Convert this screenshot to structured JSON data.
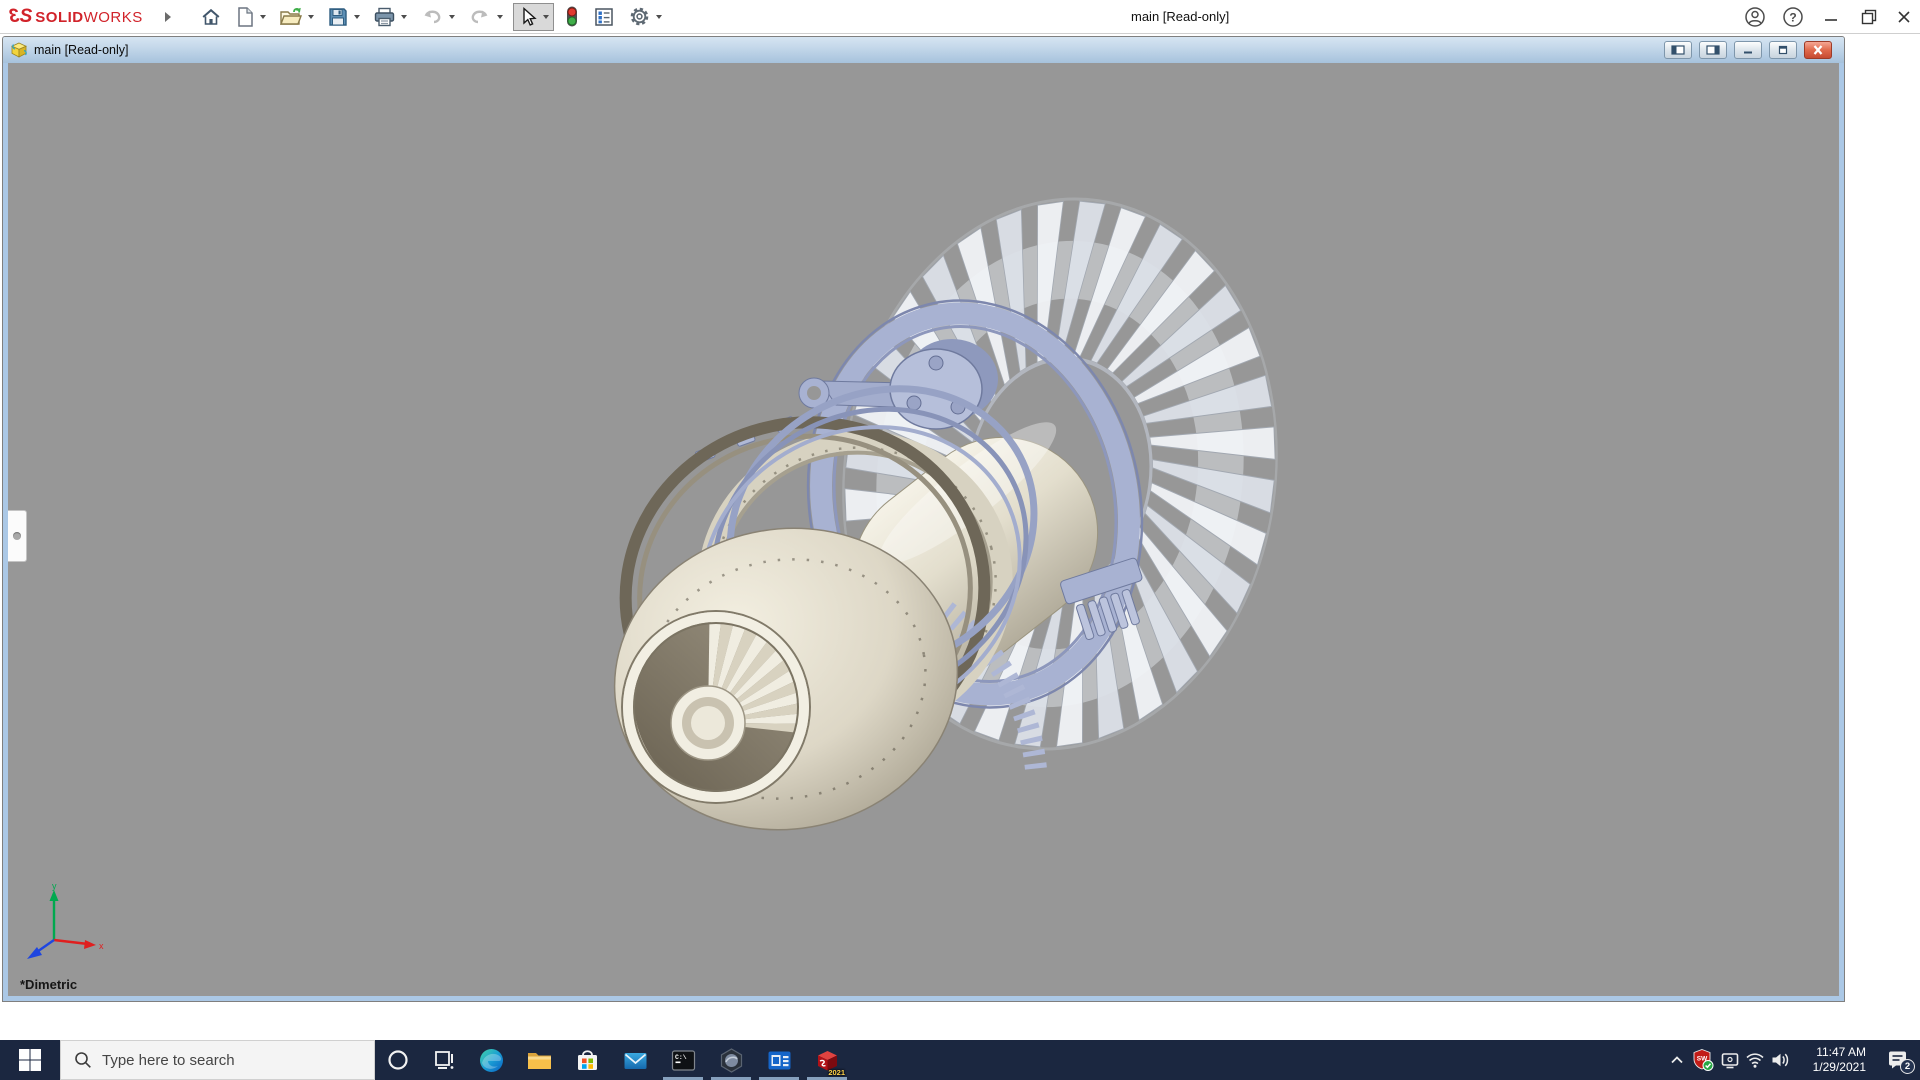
{
  "brand": {
    "mark_3": "3",
    "mark_s": "S",
    "name_bold": "SOLID",
    "name_light": "WORKS"
  },
  "window": {
    "title": "main [Read-only]",
    "controls": [
      "account",
      "help",
      "minimize",
      "restore",
      "close"
    ]
  },
  "toolbar": {
    "icons": [
      "home",
      "new-document",
      "open",
      "save",
      "print",
      "undo",
      "redo",
      "select-arrow",
      "rebuild-traffic-light",
      "file-properties",
      "options-gear"
    ]
  },
  "document": {
    "title": "main [Read-only]",
    "controls": [
      "pane-left",
      "pane-right",
      "minimize",
      "restore",
      "close"
    ],
    "view_label": "*Dimetric",
    "triad": {
      "x_label": "x",
      "y_label": "y"
    }
  },
  "viewport": {
    "background": "#979797"
  },
  "model_colors": {
    "body_cream": "#e6e1d0",
    "casing_lavender": "#a8b2d2",
    "fan_gray": "#e9ecf0",
    "dark_ring": "#6e6758"
  },
  "taskbar": {
    "search_placeholder": "Type here to search",
    "apps": [
      "edge",
      "file-explorer",
      "store",
      "mail",
      "terminal",
      "cad-viewer",
      "media-app",
      "solidworks"
    ],
    "running_apps": [
      "terminal",
      "cad-viewer",
      "media-app",
      "solidworks"
    ],
    "terminal_text": "C:\\",
    "solidworks_year": "2021",
    "tray": {
      "icons": [
        "chevron-up",
        "solidworks-monitor-shield",
        "display",
        "wifi",
        "volume",
        "action-center"
      ],
      "shield_text": "SW",
      "time": "11:47 AM",
      "date": "1/29/2021",
      "badge": "2"
    }
  },
  "colors": {
    "accent_red": "#d1232a",
    "taskbar_bg": "#1b2740",
    "doc_frame_blue": "#abc8e6",
    "titlebar_top": "#d6e5f2",
    "titlebar_bottom": "#a6c2dc"
  }
}
